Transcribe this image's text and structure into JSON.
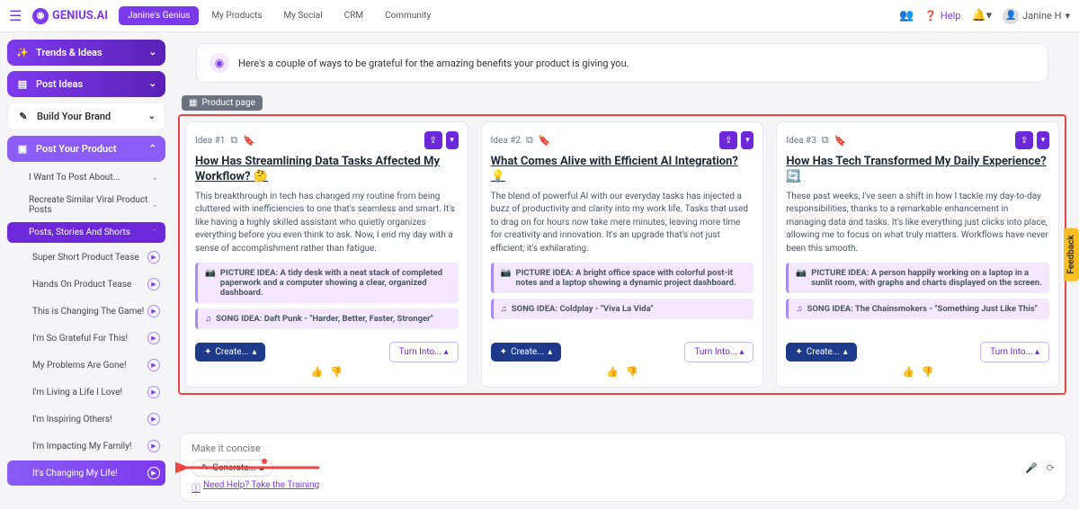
{
  "brand": "GENIUS.AI",
  "topnav": {
    "primary": "Janine's Genius",
    "items": [
      "My Products",
      "My Social",
      "CRM",
      "Community"
    ]
  },
  "help_label": "Help",
  "user_name": "Janine H",
  "sidebar": {
    "trends": "Trends & Ideas",
    "post_ideas": "Post Ideas",
    "build_brand": "Build Your Brand",
    "post_product": "Post Your Product",
    "sub": {
      "want_post_about": "I Want To Post About...",
      "recreate_viral": "Recreate Similar Viral Product Posts",
      "posts_stories": "Posts, Stories And Shorts"
    },
    "leaves": [
      "Super Short Product Tease",
      "Hands On Product Tease",
      "This is Changing The Game!",
      "I'm So Grateful For This!",
      "My Problems Are Gone!",
      "I'm Living a Life I Love!",
      "I'm Inspiring Others!",
      "I'm Impacting My Family!",
      "It's Changing My Life!"
    ]
  },
  "banner": "Here's a couple of ways to be grateful for the amazing benefits your product is giving you.",
  "page_tag": "Product page",
  "ideas": [
    {
      "label": "Idea #1",
      "title": "How Has Streamlining Data Tasks Affected My Workflow? 🤔",
      "body": "This breakthrough in tech has changed my routine from being cluttered with inefficiencies to one that's seamless and smart. It's like having a highly skilled assistant who quietly organizes everything before you even think to ask. Now, I end my day with a sense of accomplishment rather than fatigue.",
      "picture": "PICTURE IDEA: A tidy desk with a neat stack of completed paperwork and a computer showing a clear, organized dashboard.",
      "song": "SONG IDEA: Daft Punk - \"Harder, Better, Faster, Stronger\""
    },
    {
      "label": "Idea #2",
      "title": "What Comes Alive with Efficient AI Integration? 💡",
      "body": "The blend of powerful AI with our everyday tasks has injected a buzz of productivity and clarity into my work life. Tasks that used to drag on for hours now take mere minutes, leaving more time for creativity and innovation. It's an upgrade that's not just efficient; it's exhilarating.",
      "picture": "PICTURE IDEA: A bright office space with colorful post-it notes and a laptop showing a dynamic project dashboard.",
      "song": "SONG IDEA: Coldplay - \"Viva La Vida\""
    },
    {
      "label": "Idea #3",
      "title": "How Has Tech Transformed My Daily Experience? 🔄",
      "body": "These past weeks, I've seen a shift in how I tackle my day-to-day responsibilities, thanks to a remarkable enhancement in managing data and tasks. It's like everything just clicks into place, allowing me to focus on what truly matters. Workflows have never been this smooth.",
      "picture": "PICTURE IDEA: A person happily working on a laptop in a sunlit room, with graphs and charts displayed on the screen.",
      "song": "SONG IDEA: The Chainsmokers - \"Something Just Like This\""
    }
  ],
  "create_label": "Create...",
  "turn_label": "Turn Into...",
  "composer_placeholder": "Make it concise",
  "generate_label": "Generate...",
  "training_link": "Need Help? Take the Training",
  "feedback_label": "Feedback"
}
